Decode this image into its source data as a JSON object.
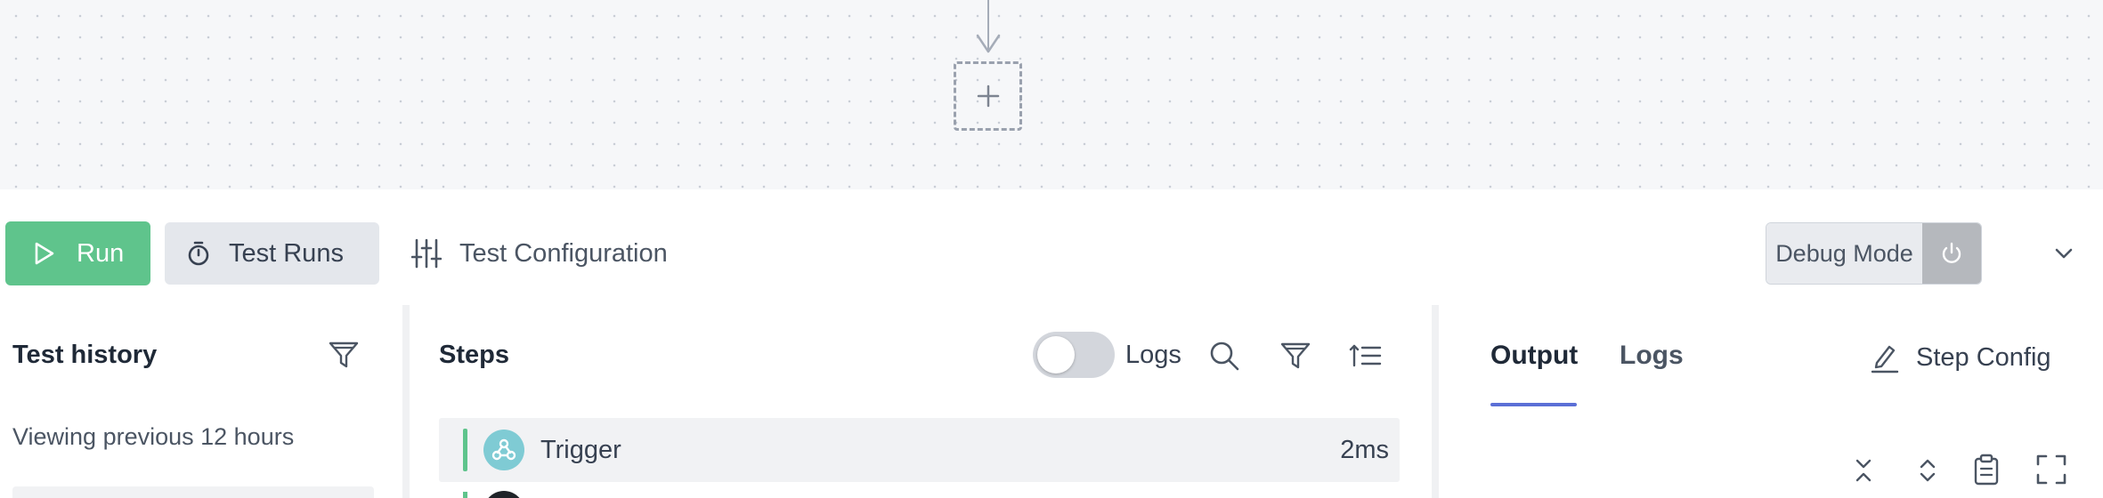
{
  "canvas": {
    "add_node_icon": "plus-icon"
  },
  "toolbar": {
    "run_label": "Run",
    "test_runs_label": "Test Runs",
    "test_configuration_label": "Test Configuration",
    "debug_mode_label": "Debug Mode"
  },
  "test_history": {
    "title": "Test history",
    "viewing_text": "Viewing previous 12 hours"
  },
  "steps": {
    "title": "Steps",
    "logs_toggle_label": "Logs",
    "logs_toggle_on": false,
    "items": [
      {
        "name": "Trigger",
        "duration": "2ms",
        "status_color": "#5fc48c",
        "icon": "webhook-icon"
      }
    ]
  },
  "output": {
    "tabs": [
      {
        "label": "Output",
        "active": true
      },
      {
        "label": "Logs",
        "active": false
      }
    ],
    "step_config_label": "Step Config"
  },
  "colors": {
    "run_button": "#5fc48c",
    "accent_tab": "#5b6fd6",
    "success": "#5fc48c"
  }
}
